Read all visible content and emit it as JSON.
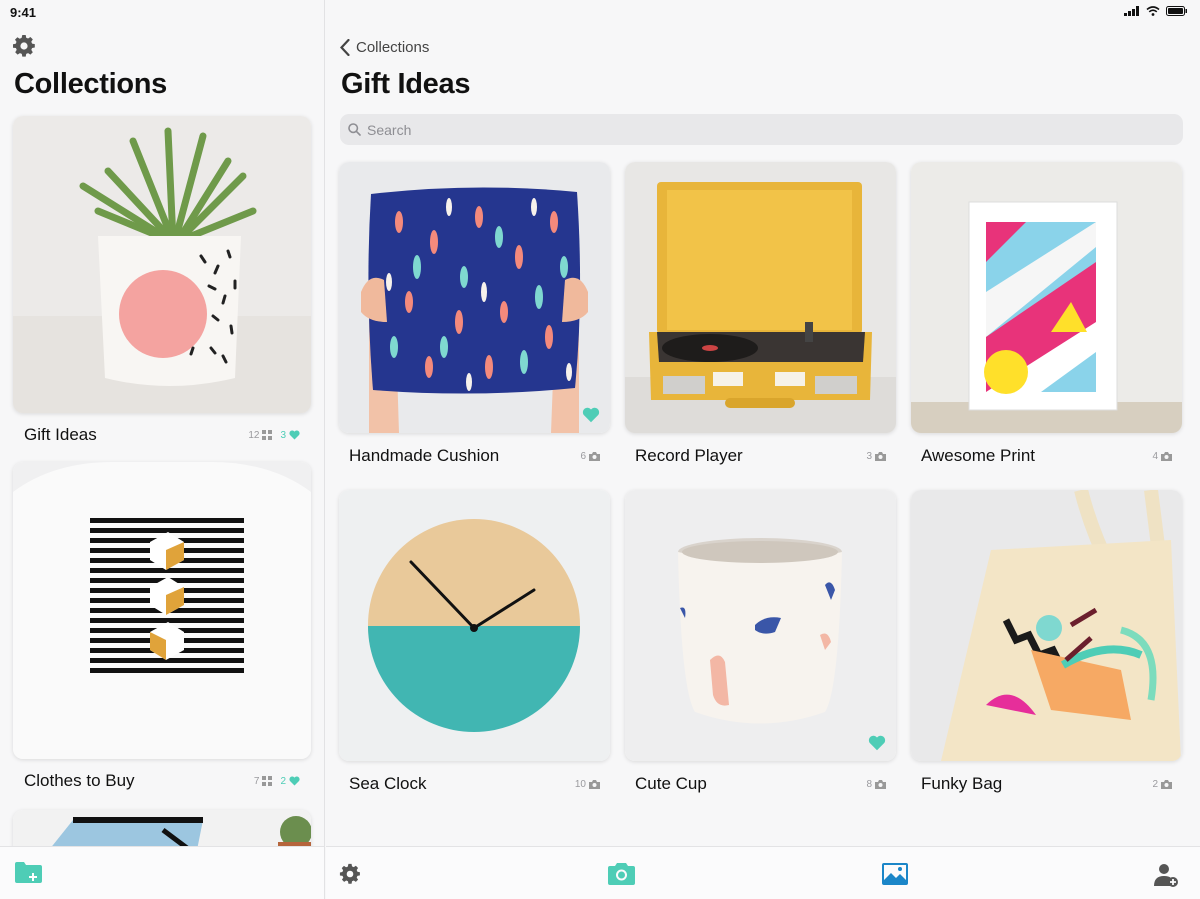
{
  "status": {
    "time": "9:41"
  },
  "sidebar": {
    "title": "Collections",
    "collections": [
      {
        "name": "Gift Ideas",
        "item_count": "12",
        "fav_count": "3"
      },
      {
        "name": "Clothes to Buy",
        "item_count": "7",
        "fav_count": "2"
      }
    ]
  },
  "main": {
    "back_label": "Collections",
    "title": "Gift Ideas",
    "search_placeholder": "Search",
    "items": [
      {
        "name": "Handmade Cushion",
        "photo_count": "6",
        "favorite": true
      },
      {
        "name": "Record Player",
        "photo_count": "3",
        "favorite": false
      },
      {
        "name": "Awesome Print",
        "photo_count": "4",
        "favorite": false
      },
      {
        "name": "Sea Clock",
        "photo_count": "10",
        "favorite": false
      },
      {
        "name": "Cute Cup",
        "photo_count": "8",
        "favorite": true
      },
      {
        "name": "Funky Bag",
        "photo_count": "2",
        "favorite": false
      }
    ]
  },
  "colors": {
    "accent": "#4ecdb6",
    "blue_accent": "#1b86c8",
    "icon_gray": "#555555"
  },
  "icons": {
    "settings": "gear-icon",
    "new_collection": "folder-plus-icon",
    "camera": "camera-icon",
    "gallery": "image-icon",
    "add_user": "person-plus-icon"
  }
}
